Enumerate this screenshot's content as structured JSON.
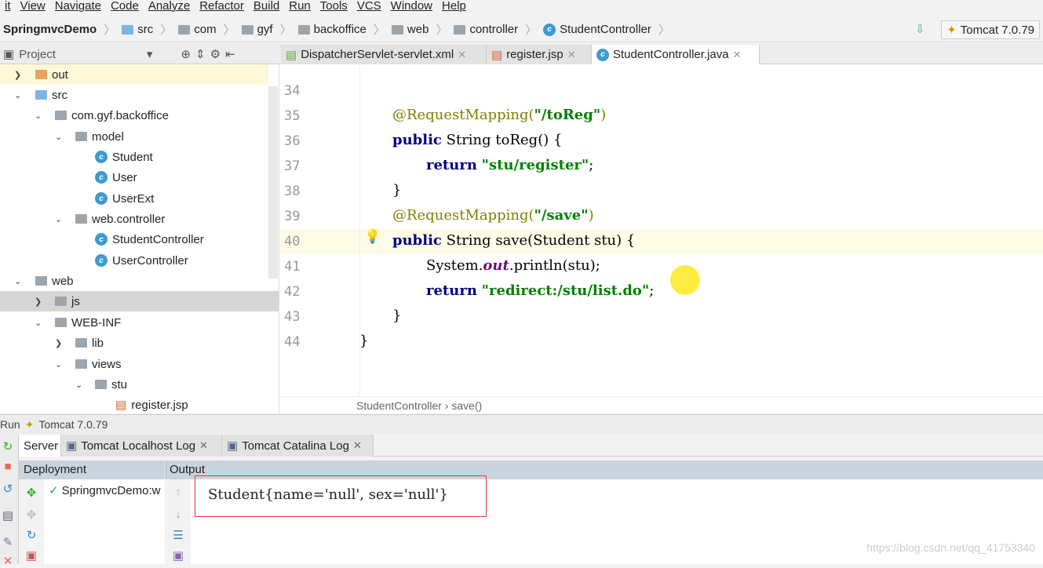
{
  "menu": [
    "it",
    "View",
    "Navigate",
    "Code",
    "Analyze",
    "Refactor",
    "Build",
    "Run",
    "Tools",
    "VCS",
    "Window",
    "Help"
  ],
  "breadcrumb": [
    "SpringmvcDemo",
    "src",
    "com",
    "gyf",
    "backoffice",
    "web",
    "controller",
    "StudentController"
  ],
  "run_config": "Tomcat 7.0.79",
  "project_panel": {
    "title": "Project"
  },
  "editor_tabs": [
    {
      "label": "DispatcherServlet-servlet.xml"
    },
    {
      "label": "register.jsp"
    },
    {
      "label": "StudentController.java"
    }
  ],
  "tree": [
    {
      "label": "out",
      "icon": "folder-orange"
    },
    {
      "label": "src",
      "icon": "folder-blue"
    },
    {
      "label": "com.gyf.backoffice",
      "icon": "package"
    },
    {
      "label": "model",
      "icon": "package"
    },
    {
      "label": "Student",
      "icon": "class"
    },
    {
      "label": "User",
      "icon": "class"
    },
    {
      "label": "UserExt",
      "icon": "class"
    },
    {
      "label": "web.controller",
      "icon": "package"
    },
    {
      "label": "StudentController",
      "icon": "class"
    },
    {
      "label": "UserController",
      "icon": "class"
    },
    {
      "label": "web",
      "icon": "folder"
    },
    {
      "label": "js",
      "icon": "folder"
    },
    {
      "label": "WEB-INF",
      "icon": "folder"
    },
    {
      "label": "lib",
      "icon": "folder"
    },
    {
      "label": "views",
      "icon": "folder"
    },
    {
      "label": "stu",
      "icon": "folder"
    },
    {
      "label": "register.jsp",
      "icon": "jsp-file"
    }
  ],
  "code": {
    "line_numbers": [
      "34",
      "35",
      "36",
      "37",
      "38",
      "39",
      "40",
      "41",
      "42",
      "43",
      "44"
    ],
    "l35a": "@RequestMapping(",
    "l35b": "\"/toReg\"",
    "l35c": ")",
    "kw_public": "public",
    "l36": " String toReg() {",
    "kw_return": "return",
    "l37s": "\"stu/register\"",
    "semi": ";",
    "close": "}",
    "l39a": "@RequestMapping(",
    "l39b": "\"/save\"",
    "l39c": ")",
    "l40": " String save(Student stu) {",
    "l41a": "System.",
    "l41b": "out",
    "l41c": ".println(stu);",
    "l42s": "\"redirect:/stu/list.do\""
  },
  "editor_breadcrumb": "StudentController › save()",
  "run": {
    "label": "Run",
    "config": "Tomcat 7.0.79",
    "tabs": [
      "Server",
      "Tomcat Localhost Log",
      "Tomcat Catalina Log"
    ],
    "deployment_header": "Deployment",
    "output_header": "Output",
    "deployment_item": "SpringmvcDemo:w",
    "output": "Student{name='null', sex='null'}"
  },
  "watermark": "https://blog.csdn.net/qq_41753340"
}
